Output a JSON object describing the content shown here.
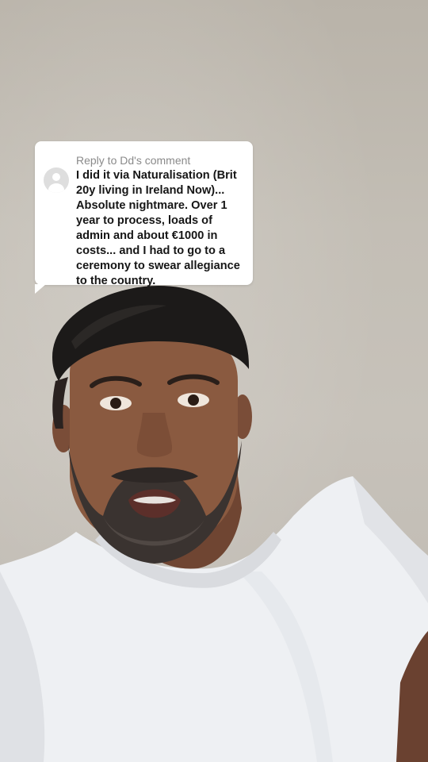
{
  "comment_reply": {
    "title": "Reply to Dd's comment",
    "text": "I did it via Naturalisation (Brit 20y living in Ireland Now)... Absolute nightmare. Over 1 year to process, loads of admin and about €1000 in costs... and I had to go to a ceremony to swear allegiance to the country."
  },
  "colors": {
    "wall": "#c3beb5",
    "shirt": "#eef0f3",
    "cap": "#1c1a19",
    "skin": "#8a5a40",
    "beard": "#3a3330"
  }
}
